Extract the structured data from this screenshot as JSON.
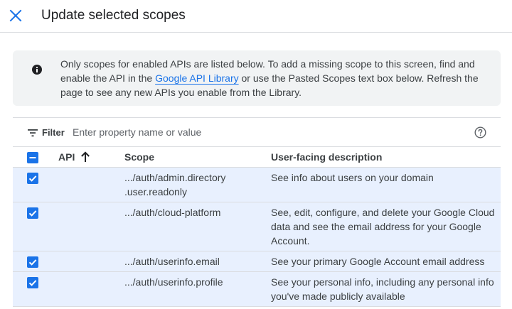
{
  "header": {
    "title": "Update selected scopes",
    "close_icon": "close-icon"
  },
  "info": {
    "icon": "info-icon",
    "text_before": "Only scopes for enabled APIs are listed below. To add a missing scope to this screen, find and enable the API in the ",
    "link_text": "Google API Library",
    "text_after": " or use the Pasted Scopes text box below. Refresh the page to see any new APIs you enable from the Library."
  },
  "filter": {
    "label": "Filter",
    "placeholder": "Enter property name or value",
    "icons": [
      "filter-icon",
      "help-icon"
    ]
  },
  "table": {
    "columns": {
      "api": "API",
      "scope": "Scope",
      "description": "User-facing description"
    },
    "sort": "ascending",
    "select_all_state": "indeterminate",
    "rows": [
      {
        "checked": true,
        "api": "",
        "scope": ".../auth/admin.directory .user.readonly",
        "description": "See info about users on your domain"
      },
      {
        "checked": true,
        "api": "",
        "scope": ".../auth/cloud-platform",
        "description": "See, edit, configure, and delete your Google Cloud data and see the email address for your Google Account."
      },
      {
        "checked": true,
        "api": "",
        "scope": ".../auth/userinfo.email",
        "description": "See your primary Google Account email address"
      },
      {
        "checked": true,
        "api": "",
        "scope": ".../auth/userinfo.profile",
        "description": "See your personal info, including any personal info you've made publicly available"
      }
    ]
  },
  "colors": {
    "accent": "#1a73e8",
    "selected_row": "#e8f0fe",
    "info_bg": "#f1f3f4",
    "divider": "#dadce0"
  }
}
